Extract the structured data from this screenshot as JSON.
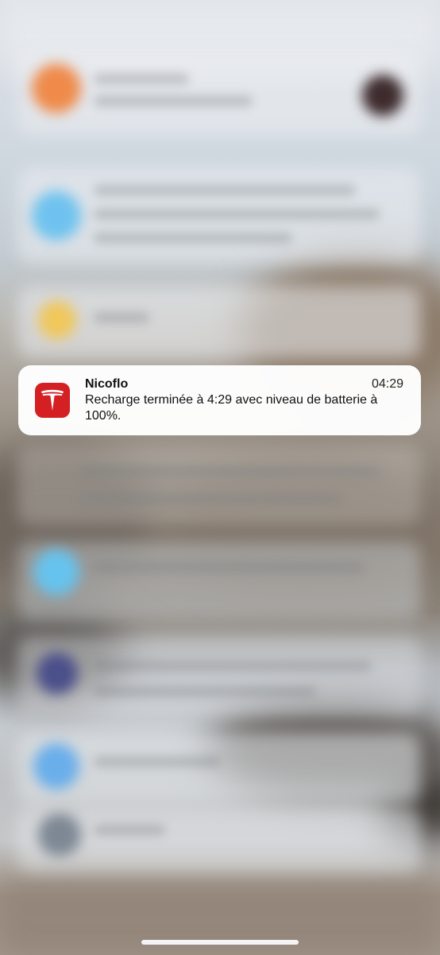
{
  "notification": {
    "app_icon": "tesla-logo-icon",
    "title": "Nicoflo",
    "time": "04:29",
    "body": "Recharge terminée à 4:29 avec niveau de batterie à 100%."
  },
  "colors": {
    "app_icon_bg": "#d41f23",
    "card_bg": "#ffffff",
    "home_indicator": "#f4f4f4"
  }
}
